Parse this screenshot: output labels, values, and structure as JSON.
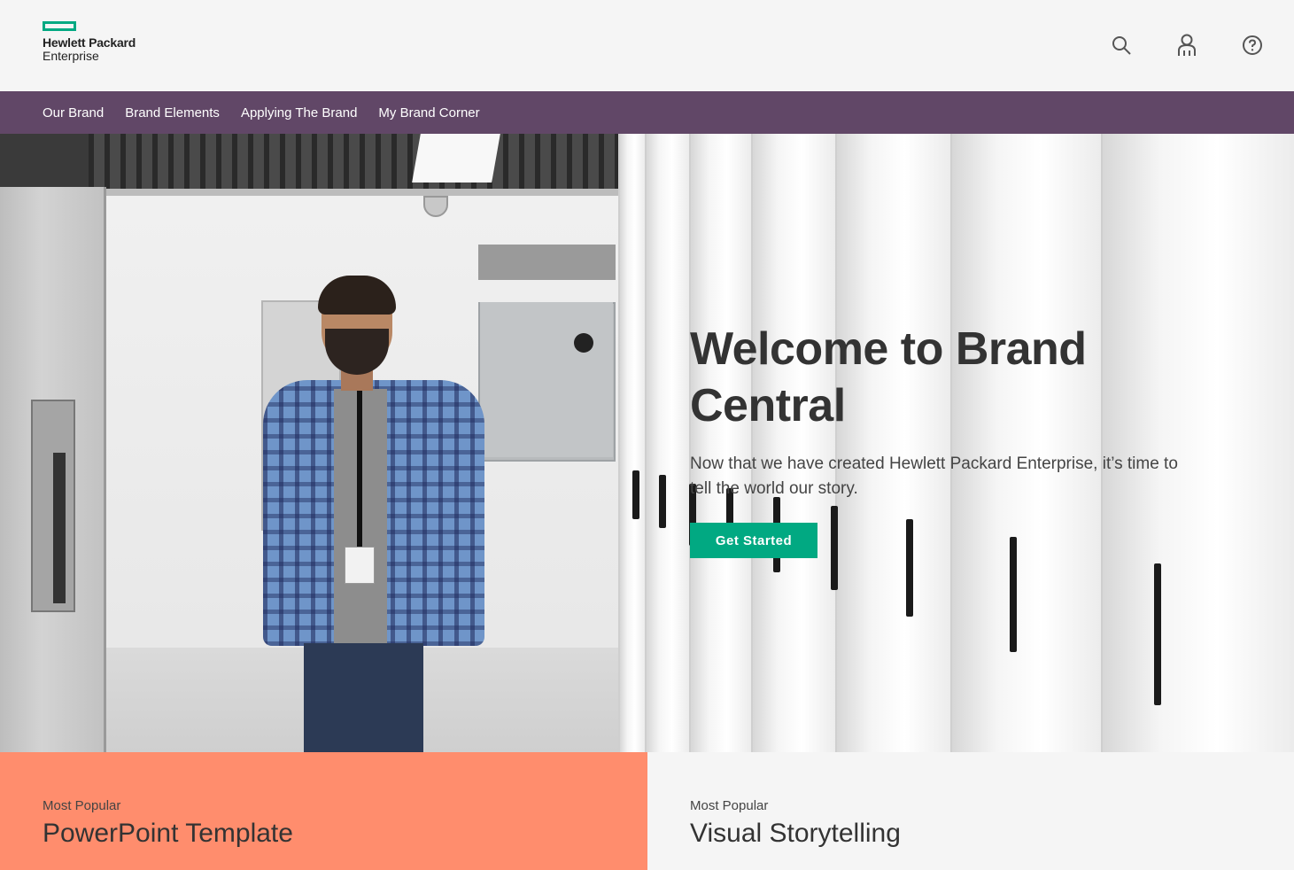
{
  "brand": {
    "logo_line1": "Hewlett Packard",
    "logo_line2": "Enterprise",
    "accent_color": "#01a982",
    "nav_color": "#614767"
  },
  "header": {
    "icons": [
      "search-icon",
      "user-icon",
      "help-icon"
    ]
  },
  "nav": {
    "items": [
      {
        "label": "Our Brand"
      },
      {
        "label": "Brand Elements"
      },
      {
        "label": "Applying The Brand"
      },
      {
        "label": "My Brand Corner"
      }
    ]
  },
  "hero": {
    "title": "Welcome to Brand Central",
    "subtitle": "Now that we have created Hewlett Packard Enterprise, it’s time to tell the world our story.",
    "cta_label": "Get Started"
  },
  "cards": [
    {
      "kicker": "Most Popular",
      "title": "PowerPoint Template",
      "color": "#ff8d6d"
    },
    {
      "kicker": "Most Popular",
      "title": "Visual Storytelling",
      "color": "#f5f5f5"
    }
  ]
}
